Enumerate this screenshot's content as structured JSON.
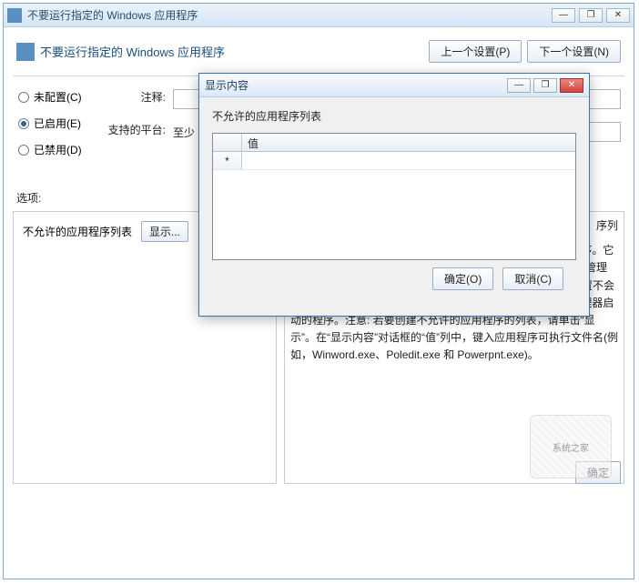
{
  "mainWindow": {
    "title": "不要运行指定的 Windows 应用程序",
    "winButtons": {
      "min": "—",
      "max": "❐",
      "close": "✕"
    }
  },
  "policy": {
    "title": "不要运行指定的 Windows 应用程序",
    "prevBtn": "上一个设置(P)",
    "nextBtn": "下一个设置(N)"
  },
  "radios": {
    "notConfigured": "未配置(C)",
    "enabled": "已启用(E)",
    "disabled": "已禁用(D)",
    "selected": "enabled"
  },
  "labels": {
    "comment": "注释:",
    "platform": "支持的平台:",
    "platformPrefix": "至少",
    "options": "选项:"
  },
  "optionsPane": {
    "listLabel": "不允许的应用程序列表",
    "showBtn": "显示..."
  },
  "description": {
    "lineTop": "序列",
    "body": "此设置仅阻止用户运行由 Windows 资源管理器进程启动的程序。它不会阻止用户运行由系统进程或其他进程启动的程序，如任务管理器。另外，如果允许用户使用命令提示符(Cmd.exe)，则此设置不会阻止用户在命令窗口中启动不允许他们使用 Windows 资源管理器启动的程序。注意: 若要创建不允许的应用程序的列表，请单击“显示”。在“显示内容”对话框的“值”列中，键入应用程序可执行文件名(例如，Winword.exe、Poledit.exe 和 Powerpnt.exe)。"
  },
  "footer": {
    "ok": "确定"
  },
  "dialog": {
    "title": "显示内容",
    "winButtons": {
      "min": "—",
      "max": "❐",
      "close": "✕"
    },
    "subtitle": "不允许的应用程序列表",
    "columnHeader": "值",
    "newRowMarker": "*",
    "ok": "确定(O)",
    "cancel": "取消(C)"
  },
  "watermark": "系统之家"
}
